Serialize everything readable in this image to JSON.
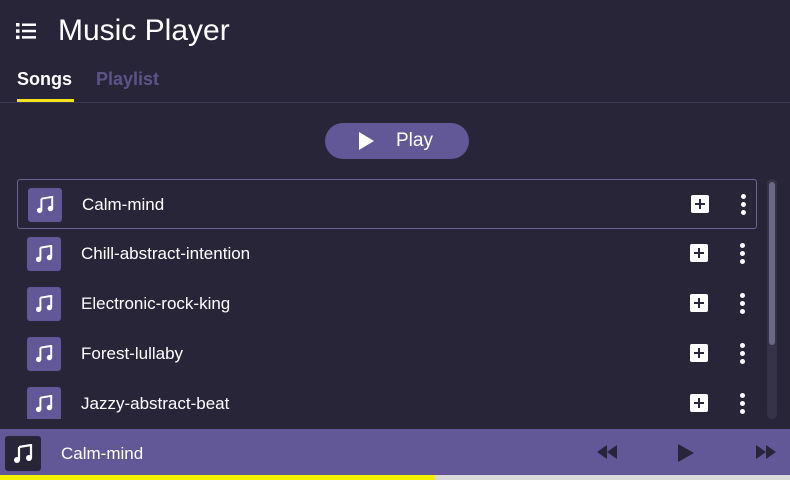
{
  "header": {
    "title": "Music Player",
    "menu_icon": "menu-list-icon"
  },
  "tabs": [
    {
      "label": "Songs",
      "active": true
    },
    {
      "label": "Playlist",
      "active": false
    }
  ],
  "actions": {
    "play_label": "Play"
  },
  "songs": [
    {
      "title": "Calm-mind",
      "selected": true
    },
    {
      "title": "Chill-abstract-intention",
      "selected": false
    },
    {
      "title": "Electronic-rock-king",
      "selected": false
    },
    {
      "title": "Forest-lullaby",
      "selected": false
    },
    {
      "title": "Jazzy-abstract-beat",
      "selected": false
    }
  ],
  "now_playing": {
    "title": "Calm-mind",
    "progress_fraction": 0.55
  },
  "colors": {
    "background": "#282539",
    "accent": "#625797",
    "tab_active_indicator": "#f3e31b",
    "tab_inactive": "#5c5488",
    "progress_fill": "#f3f000"
  },
  "icons": {
    "song_art": "music-note-icon",
    "add": "plus-square-icon",
    "more": "vertical-dots-icon",
    "prev": "rewind-icon",
    "play": "play-icon",
    "next": "fast-forward-icon"
  }
}
